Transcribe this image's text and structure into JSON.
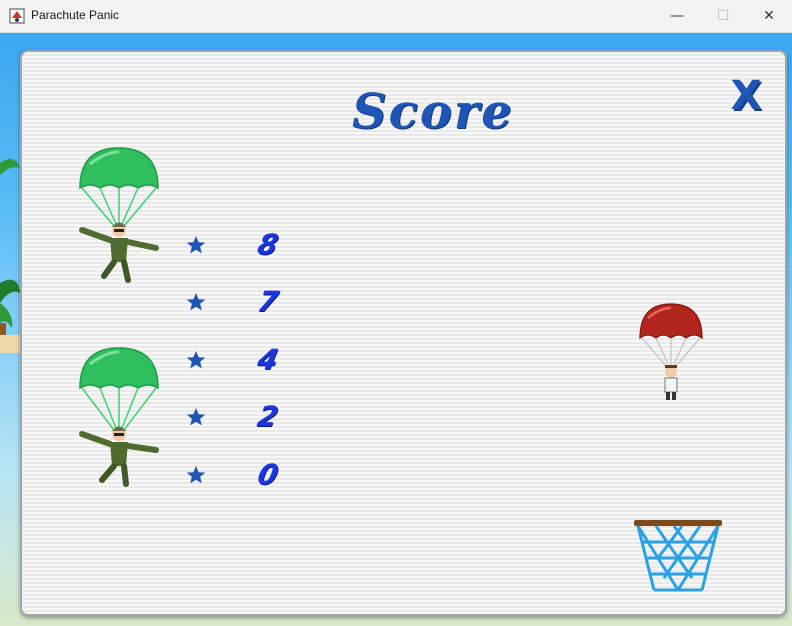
{
  "window": {
    "title": "Parachute Panic"
  },
  "window_controls": {
    "minimize": "—",
    "maximize": "☐",
    "close": "✕"
  },
  "score_panel": {
    "title": "Score",
    "close_glyph": "X",
    "scores": [
      "8",
      "7",
      "4",
      "2",
      "0"
    ]
  },
  "colors": {
    "accent": "#1f55b5",
    "score_text": "#1a36e0",
    "parachute_green": "#2fbf5f",
    "parachute_red": "#b3261e",
    "basket_net": "#29a3e6",
    "basket_rim": "#7a4a1a"
  },
  "icons": [
    "app-icon",
    "close-icon",
    "star-icon",
    "green-parachute-soldier",
    "red-parachute-jumper",
    "basketball-hoop"
  ]
}
